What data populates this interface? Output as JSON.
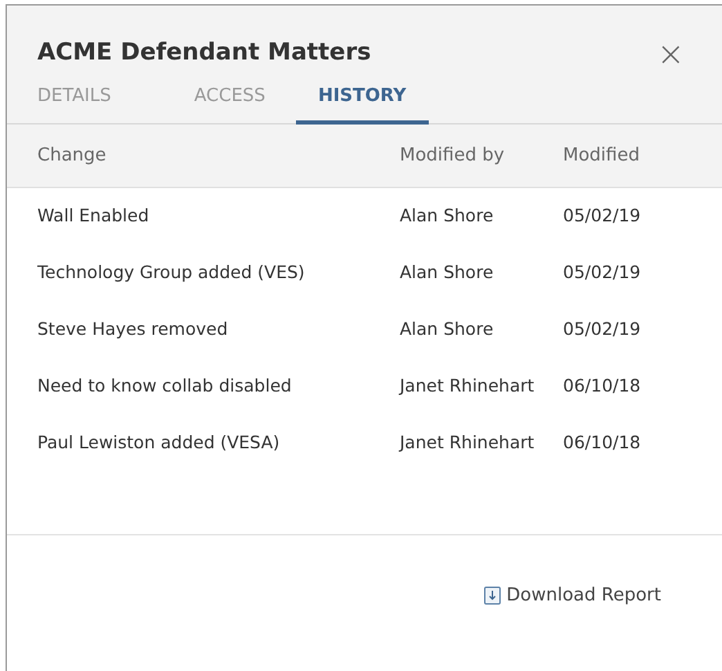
{
  "dialog": {
    "title": "ACME Defendant Matters",
    "close": "×"
  },
  "tabs": [
    {
      "label": "DETAILS",
      "selected": false
    },
    {
      "label": "ACCESS",
      "selected": false
    },
    {
      "label": "HISTORY",
      "selected": true
    }
  ],
  "table": {
    "columns": [
      "Change",
      "Modified by",
      "Modified"
    ],
    "rows": [
      [
        "Wall Enabled",
        "Alan Shore",
        "05/02/19"
      ],
      [
        "Technology Group added (VES)",
        "Alan Shore",
        "05/02/19"
      ],
      [
        "Steve Hayes removed",
        "Alan Shore",
        "05/02/19"
      ],
      [
        "Need to know collab disabled",
        "Janet Rhinehart",
        "06/10/18"
      ],
      [
        "Paul Lewiston added (VESA)",
        "Janet Rhinehart",
        "06/10/18"
      ]
    ]
  },
  "footer": {
    "link": "Download Report"
  }
}
